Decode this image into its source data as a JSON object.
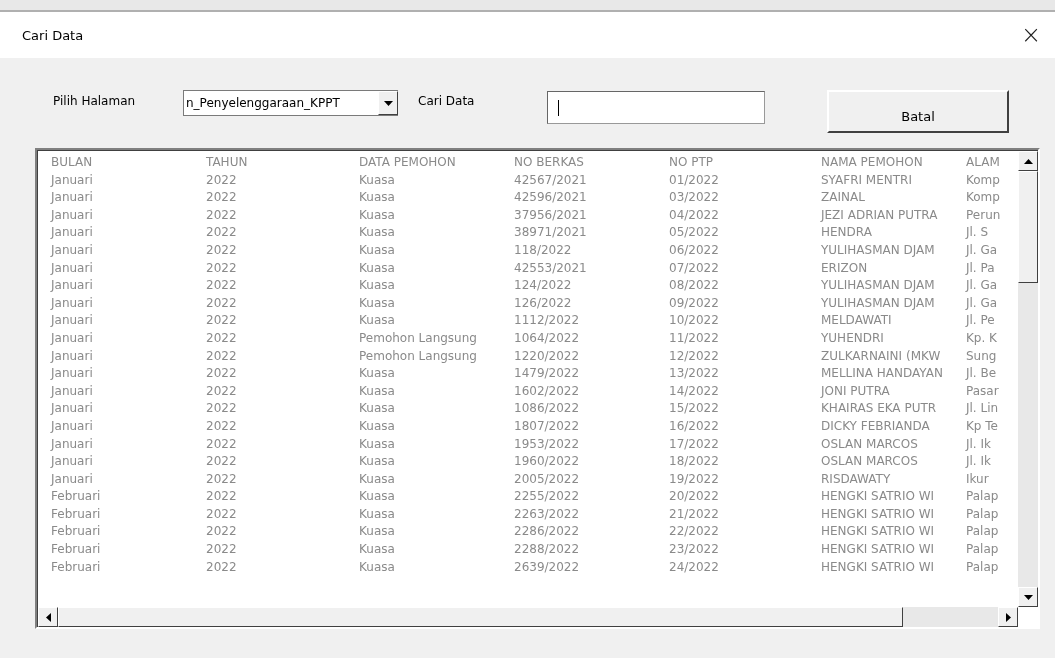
{
  "window": {
    "title": "Cari Data",
    "close": "×"
  },
  "controls": {
    "page_label": "Pilih Halaman",
    "page_value": "n_Penyelenggaraan_KPPT",
    "search_label": "Cari Data",
    "cancel_button": "Batal"
  },
  "table": {
    "columns": [
      "BULAN",
      "TAHUN",
      "DATA PEMOHON",
      "NO BERKAS",
      "NO PTP",
      "NAMA PEMOHON",
      "ALAM"
    ],
    "rows": [
      [
        "Januari",
        "2022",
        "Kuasa",
        "42567/2021",
        "01/2022",
        "SYAFRI MENTRI",
        "Komp"
      ],
      [
        "Januari",
        "2022",
        "Kuasa",
        "42596/2021",
        "03/2022",
        "ZAINAL",
        "Komp"
      ],
      [
        "Januari",
        "2022",
        "Kuasa",
        "37956/2021",
        "04/2022",
        "JEZI ADRIAN PUTRA",
        "Perun"
      ],
      [
        "Januari",
        "2022",
        "Kuasa",
        "38971/2021",
        "05/2022",
        "HENDRA",
        "Jl. S"
      ],
      [
        "Januari",
        "2022",
        "Kuasa",
        "118/2022",
        "06/2022",
        "YULIHASMAN DJAM",
        "Jl. Ga"
      ],
      [
        "Januari",
        "2022",
        "Kuasa",
        "42553/2021",
        "07/2022",
        "ERIZON",
        "Jl. Pa"
      ],
      [
        "Januari",
        "2022",
        "Kuasa",
        "124/2022",
        "08/2022",
        "YULIHASMAN DJAM",
        "Jl. Ga"
      ],
      [
        "Januari",
        "2022",
        "Kuasa",
        "126/2022",
        "09/2022",
        "YULIHASMAN DJAM",
        "Jl. Ga"
      ],
      [
        "Januari",
        "2022",
        "Kuasa",
        "1112/2022",
        "10/2022",
        "MELDAWATI",
        "Jl. Pe"
      ],
      [
        "Januari",
        "2022",
        "Pemohon Langsung",
        "1064/2022",
        "11/2022",
        "YUHENDRI",
        "Kp. K"
      ],
      [
        "Januari",
        "2022",
        "Pemohon Langsung",
        "1220/2022",
        "12/2022",
        "ZULKARNAINI (MKW",
        "Sung"
      ],
      [
        "Januari",
        "2022",
        "Kuasa",
        "1479/2022",
        "13/2022",
        "MELLINA HANDAYAN",
        "Jl. Be"
      ],
      [
        "Januari",
        "2022",
        "Kuasa",
        "1602/2022",
        "14/2022",
        "JONI PUTRA",
        "Pasar"
      ],
      [
        "Januari",
        "2022",
        "Kuasa",
        "1086/2022",
        "15/2022",
        "KHAIRAS EKA PUTR",
        "Jl. Lin"
      ],
      [
        "Januari",
        "2022",
        "Kuasa",
        "1807/2022",
        "16/2022",
        "DICKY FEBRIANDA",
        "Kp Te"
      ],
      [
        "Januari",
        "2022",
        "Kuasa",
        "1953/2022",
        "17/2022",
        "OSLAN MARCOS",
        "Jl. Ik"
      ],
      [
        "Januari",
        "2022",
        "Kuasa",
        "1960/2022",
        "18/2022",
        "OSLAN MARCOS",
        "Jl. Ik"
      ],
      [
        "Januari",
        "2022",
        "Kuasa",
        "2005/2022",
        "19/2022",
        "RISDAWATY",
        "Ikur"
      ],
      [
        "Februari",
        "2022",
        "Kuasa",
        "2255/2022",
        "20/2022",
        "HENGKI SATRIO WI",
        "Palap"
      ],
      [
        "Februari",
        "2022",
        "Kuasa",
        "2263/2022",
        "21/2022",
        "HENGKI SATRIO WI",
        "Palap"
      ],
      [
        "Februari",
        "2022",
        "Kuasa",
        "2286/2022",
        "22/2022",
        "HENGKI SATRIO WI",
        "Palap"
      ],
      [
        "Februari",
        "2022",
        "Kuasa",
        "2288/2022",
        "23/2022",
        "HENGKI SATRIO WI",
        "Palap"
      ],
      [
        "Februari",
        "2022",
        "Kuasa",
        "2639/2022",
        "24/2022",
        "HENGKI SATRIO WI",
        "Palap"
      ]
    ]
  }
}
